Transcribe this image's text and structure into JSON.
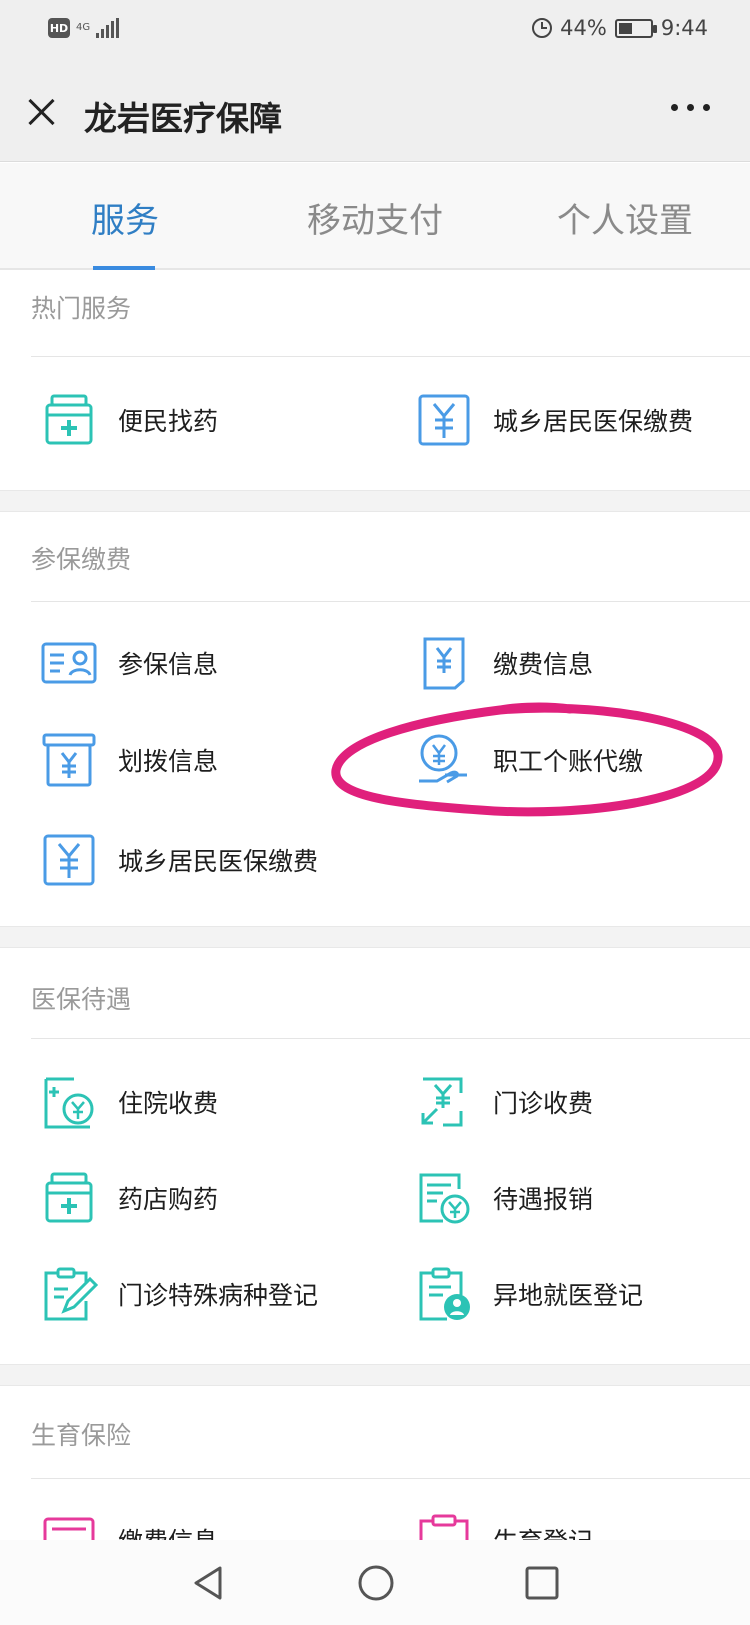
{
  "status_bar": {
    "hd": "HD",
    "network": "4G",
    "battery_text": "44%",
    "battery_level": 0.44,
    "time": "9:44"
  },
  "header": {
    "title": "龙岩医疗保障"
  },
  "tabs": [
    {
      "label": "服务",
      "active": true
    },
    {
      "label": "移动支付",
      "active": false
    },
    {
      "label": "个人设置",
      "active": false
    }
  ],
  "sections": {
    "hot": {
      "title": "热门服务",
      "items": [
        {
          "label": "便民找药",
          "icon": "medicine-box-icon"
        },
        {
          "label": "城乡居民医保缴费",
          "icon": "yuan-bill-icon"
        }
      ]
    },
    "insurance_payment": {
      "title": "参保缴费",
      "items": [
        {
          "label": "参保信息",
          "icon": "id-card-icon"
        },
        {
          "label": "缴费信息",
          "icon": "yuan-receipt-icon"
        },
        {
          "label": "划拨信息",
          "icon": "yuan-box-icon"
        },
        {
          "label": "职工个账代缴",
          "icon": "hand-coin-icon"
        },
        {
          "label": "城乡居民医保缴费",
          "icon": "yuan-bill-icon"
        }
      ]
    },
    "benefits": {
      "title": "医保待遇",
      "items": [
        {
          "label": "住院收费",
          "icon": "hospital-fee-icon"
        },
        {
          "label": "门诊收费",
          "icon": "outpatient-fee-icon"
        },
        {
          "label": "药店购药",
          "icon": "medicine-box-icon"
        },
        {
          "label": "待遇报销",
          "icon": "reimburse-icon"
        },
        {
          "label": "门诊特殊病种登记",
          "icon": "clipboard-pen-icon"
        },
        {
          "label": "异地就医登记",
          "icon": "clipboard-person-icon"
        }
      ]
    },
    "maternity": {
      "title": "生育保险",
      "items": [
        {
          "label": "缴费信息",
          "icon": "pink-card-icon"
        },
        {
          "label": "生育登记",
          "icon": "pink-clipboard-icon"
        }
      ]
    }
  },
  "colors": {
    "teal": "#2cc3b5",
    "blue": "#4a9be6",
    "pink": "#e6399b",
    "active_tab": "#2f7ec4"
  }
}
